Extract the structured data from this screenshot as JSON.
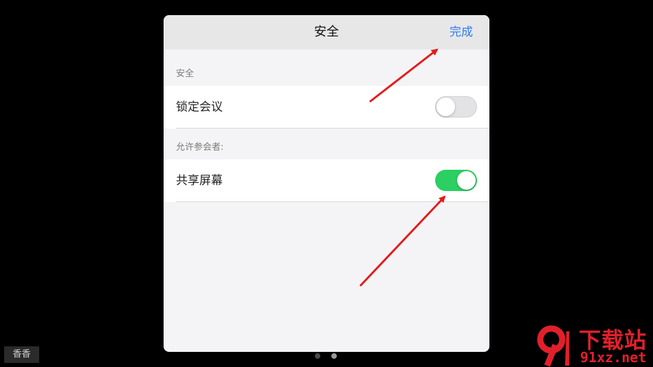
{
  "modal": {
    "title": "安全",
    "done_label": "完成"
  },
  "sections": {
    "security_label": "安全",
    "allow_label": "允许参会者:"
  },
  "rows": {
    "lock_meeting": {
      "label": "锁定会议",
      "state": "off"
    },
    "share_screen": {
      "label": "共享屏幕",
      "state": "on"
    }
  },
  "page_dots": {
    "count": 2,
    "active_index": 1
  },
  "corner_label": "香香",
  "watermark": {
    "top_text": "下载站",
    "bottom_text": "91xz.net"
  },
  "colors": {
    "accent": "#2f7cf6",
    "toggle_on": "#2bcf62",
    "toggle_off": "#e3e3e5",
    "annotation_arrow": "#e31b1b",
    "watermark": "#e0202a"
  },
  "icons": {
    "annotation": "red-arrow-icon",
    "watermark_logo": "91-logo-icon"
  }
}
